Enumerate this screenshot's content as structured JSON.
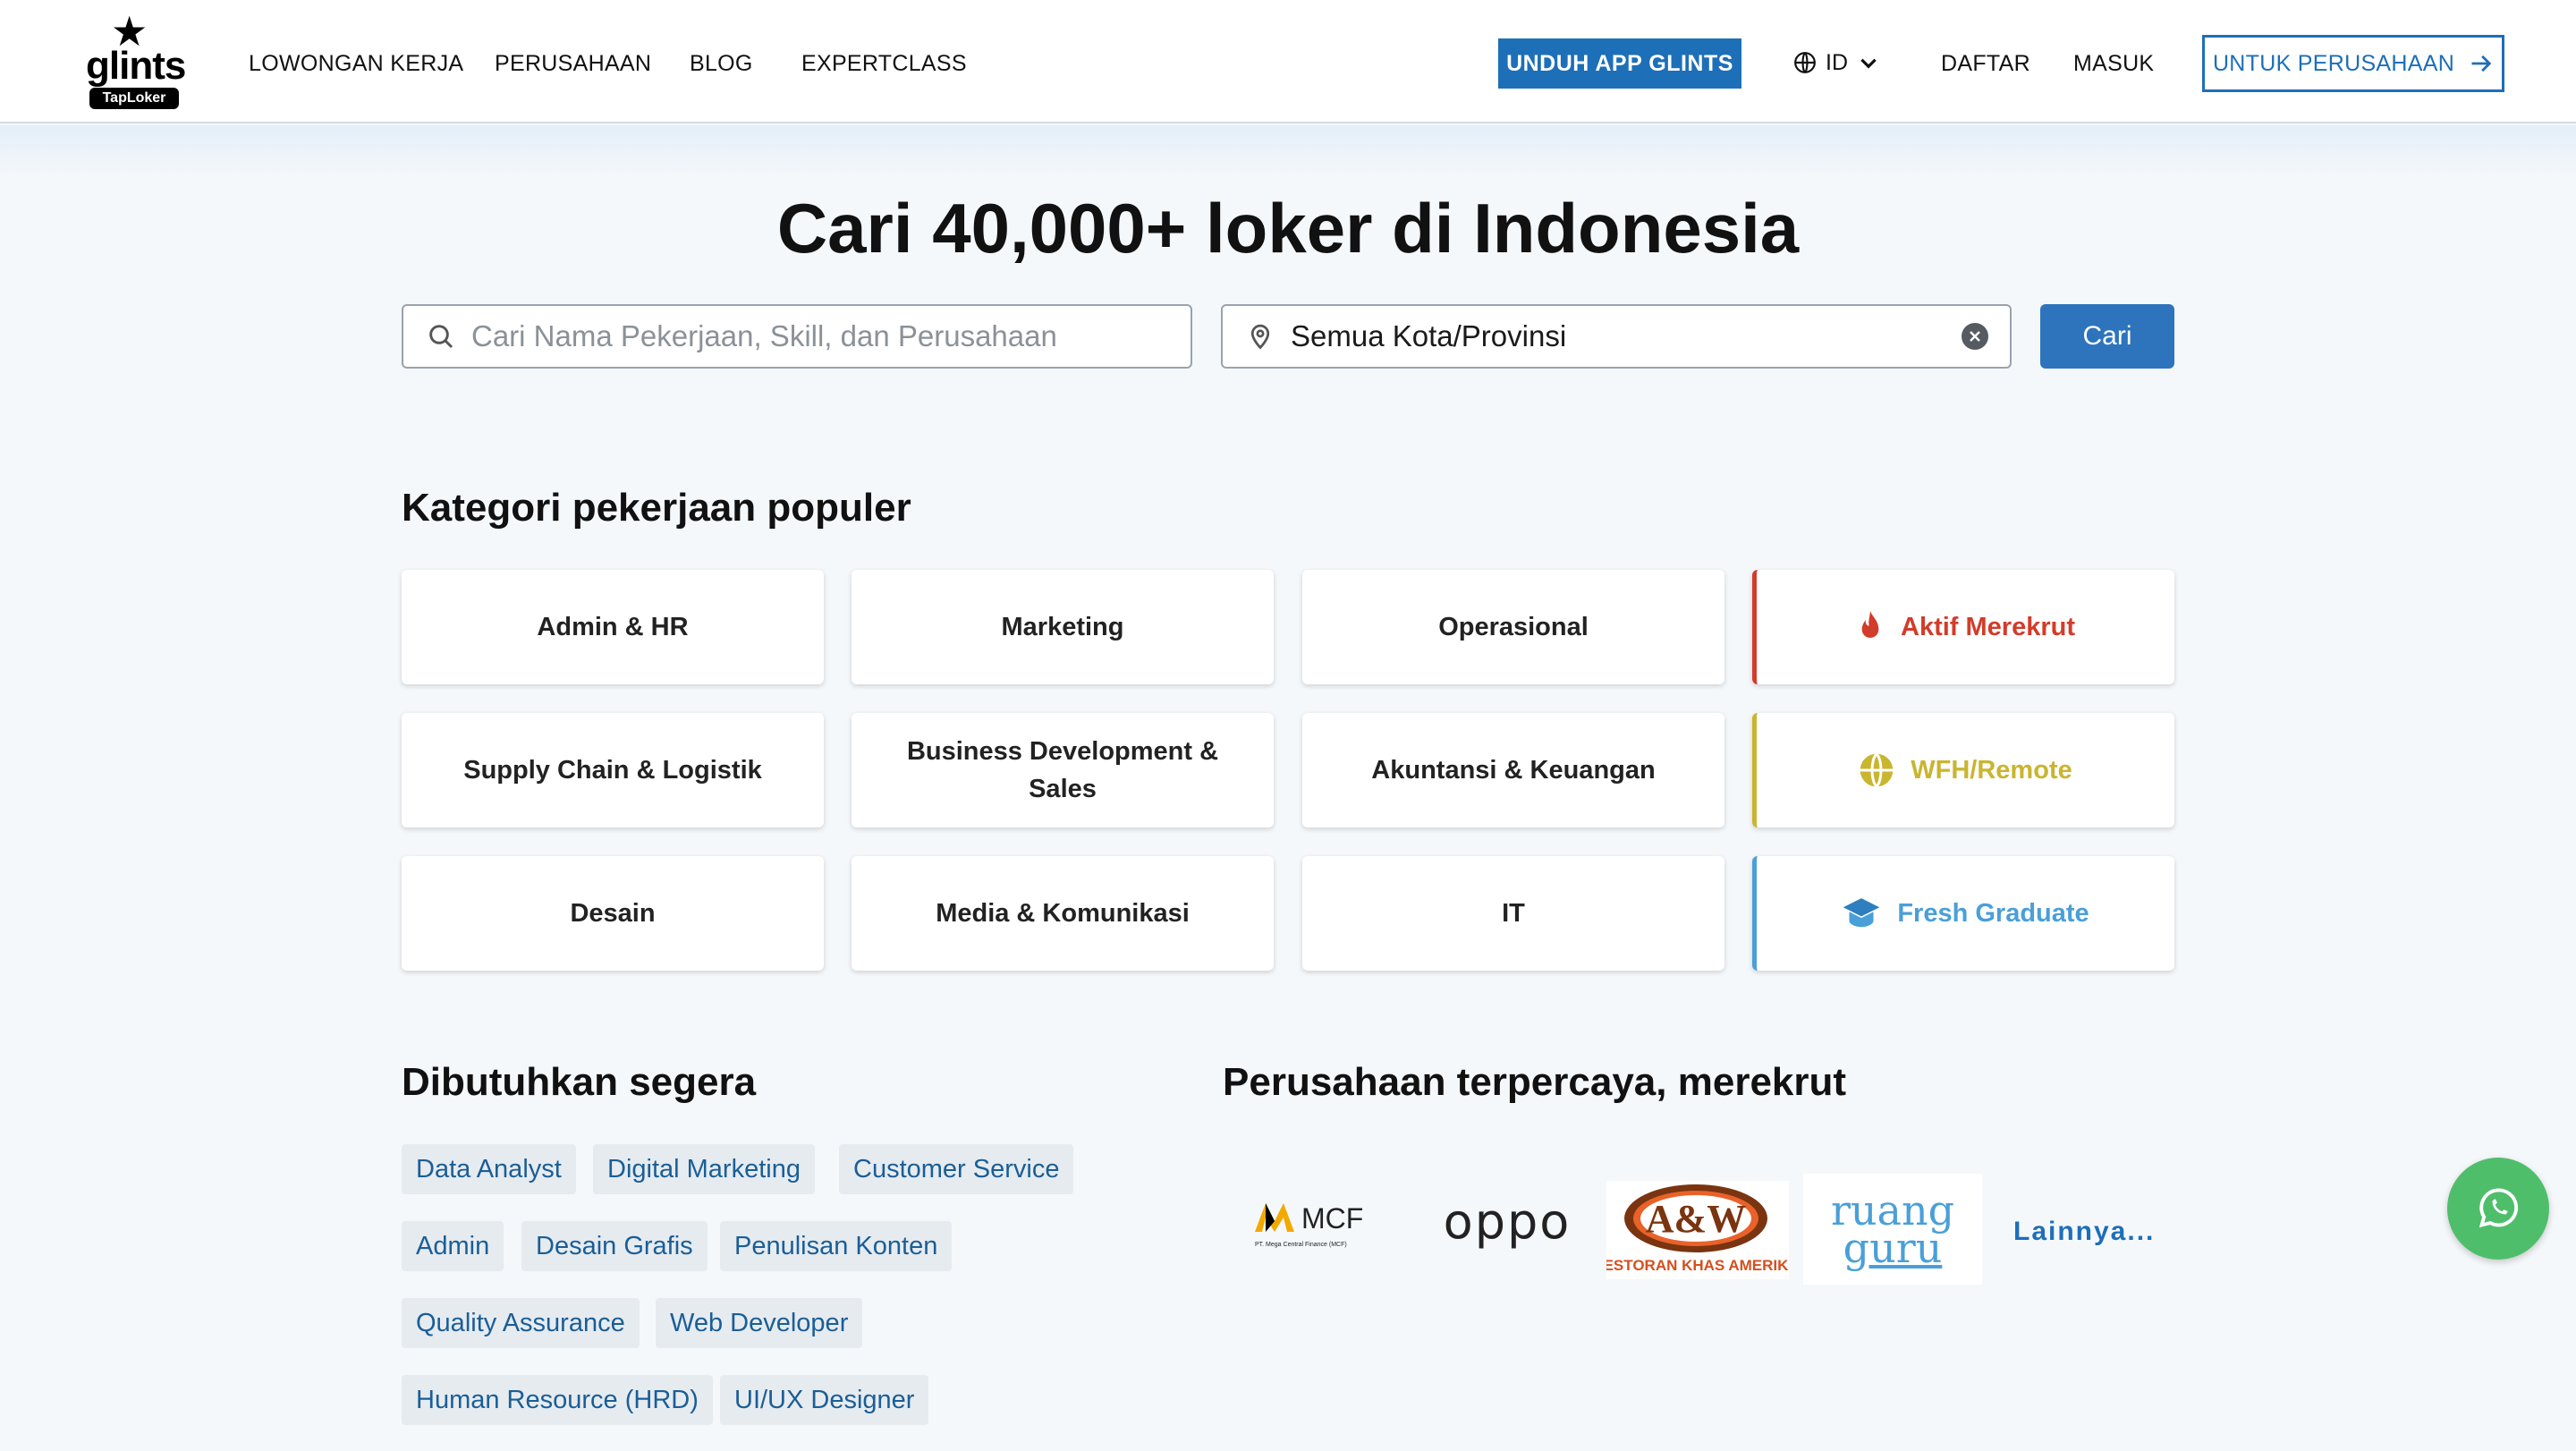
{
  "brand": {
    "logo_word": "glints",
    "logo_badge": "TapLoker"
  },
  "nav": {
    "links": [
      "LOWONGAN KERJA",
      "PERUSAHAAN",
      "BLOG",
      "EXPERTCLASS"
    ],
    "download_app": "UNDUH APP GLINTS",
    "language": "ID",
    "register": "DAFTAR",
    "login": "MASUK",
    "for_company": "UNTUK PERUSAHAAN"
  },
  "hero": {
    "title": "Cari 40,000+ loker di Indonesia",
    "search_placeholder": "Cari Nama Pekerjaan, Skill, dan Perusahaan",
    "location_value": "Semua Kota/Provinsi",
    "search_button": "Cari"
  },
  "categories": {
    "title": "Kategori pekerjaan populer",
    "items": [
      "Admin & HR",
      "Marketing",
      "Operasional",
      "Supply Chain & Logistik",
      "Business Development & Sales",
      "Akuntansi & Keuangan",
      "Desain",
      "Media & Komunikasi",
      "IT"
    ],
    "special": [
      {
        "label": "Aktif Merekrut",
        "icon": "flame-icon",
        "color": "#d23c2a"
      },
      {
        "label": "WFH/Remote",
        "icon": "globe-icon",
        "color": "#c9b530"
      },
      {
        "label": "Fresh Graduate",
        "icon": "graduation-cap-icon",
        "color": "#4a9fd8"
      }
    ]
  },
  "urgent": {
    "title": "Dibutuhkan segera",
    "tags": [
      "Data Analyst",
      "Digital Marketing",
      "Customer Service",
      "Admin",
      "Desain Grafis",
      "Penulisan Konten",
      "Quality Assurance",
      "Web Developer",
      "Human Resource (HRD)",
      "UI/UX Designer"
    ]
  },
  "companies": {
    "title": "Perusahaan terpercaya, merekrut",
    "logos": [
      {
        "name": "MCF",
        "subtitle": "PT. Mega Central Finance (MCF)"
      },
      {
        "name": "oppo"
      },
      {
        "name": "A&W",
        "subtitle": "RESTORAN KHAS AMERIKA"
      },
      {
        "name": "ruangguru",
        "line1": "ruang",
        "line2": "guru"
      }
    ],
    "more": "Lainnya..."
  },
  "colors": {
    "primary": "#1d6fb8",
    "tag_text": "#1a5e96",
    "whatsapp": "#4fbe6b"
  }
}
